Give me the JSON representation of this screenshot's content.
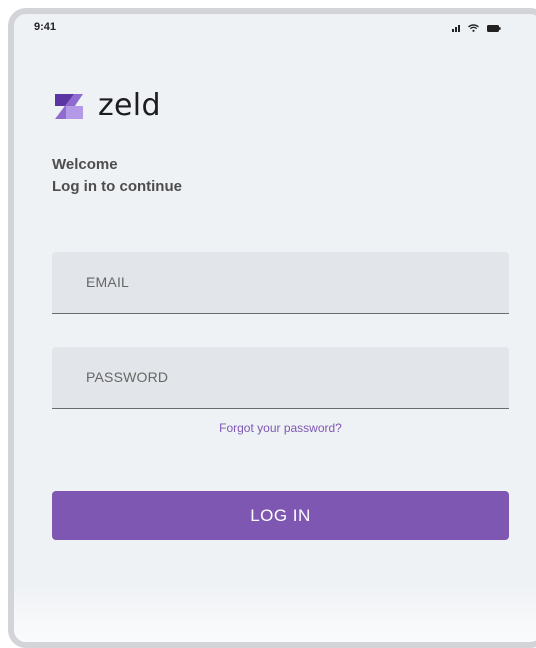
{
  "status_bar": {
    "time": "9:41",
    "icons": [
      "signal-icon",
      "wifi-icon",
      "battery-icon"
    ]
  },
  "brand": {
    "name": "zeld",
    "logo_icon": "zeld-logo-icon",
    "logo_colors": [
      "#5b36a3",
      "#a98be0"
    ]
  },
  "welcome": {
    "title": "Welcome",
    "subtitle": "Log in to continue"
  },
  "form": {
    "email_label": "EMAIL",
    "password_label": "PASSWORD",
    "forgot_password": "Forgot your password?",
    "login_button": "LOG IN"
  },
  "colors": {
    "accent": "#7e57b3",
    "background": "#eff2f5",
    "field_background": "#e2e5e9"
  }
}
